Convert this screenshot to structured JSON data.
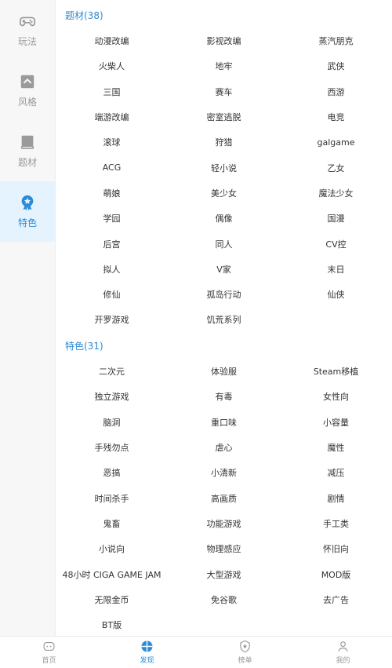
{
  "sidebar": {
    "items": [
      {
        "label": "玩法",
        "icon": "gamepad-icon"
      },
      {
        "label": "风格",
        "icon": "chevron-box-icon"
      },
      {
        "label": "题材",
        "icon": "book-icon"
      },
      {
        "label": "特色",
        "icon": "star-badge-icon",
        "active": true
      }
    ]
  },
  "sections": [
    {
      "title": "题材(38)",
      "tags": [
        "动漫改编",
        "影视改编",
        "蒸汽朋克",
        "火柴人",
        "地牢",
        "武侠",
        "三国",
        "赛车",
        "西游",
        "端游改编",
        "密室逃脱",
        "电竞",
        "滚球",
        "狩猎",
        "galgame",
        "ACG",
        "轻小说",
        "乙女",
        "萌娘",
        "美少女",
        "魔法少女",
        "学园",
        "偶像",
        "国漫",
        "后宫",
        "同人",
        "CV控",
        "拟人",
        "V家",
        "末日",
        "修仙",
        "孤岛行动",
        "仙侠",
        "开罗游戏",
        "饥荒系列"
      ]
    },
    {
      "title": "特色(31)",
      "tags": [
        "二次元",
        "体验服",
        "Steam移植",
        "独立游戏",
        "有毒",
        "女性向",
        "脑洞",
        "重口味",
        "小容量",
        "手残勿点",
        "虐心",
        "魔性",
        "恶搞",
        "小清新",
        "减压",
        "时间杀手",
        "高画质",
        "剧情",
        "鬼畜",
        "功能游戏",
        "手工类",
        "小说向",
        "物理感应",
        "怀旧向",
        "48小时 CIGA GAME JAM",
        "大型游戏",
        "MOD版",
        "无限金币",
        "免谷歌",
        "去广告",
        "BT版"
      ]
    }
  ],
  "bottom_nav": [
    {
      "label": "首页",
      "icon": "home-gamepad-icon"
    },
    {
      "label": "发现",
      "icon": "discover-icon",
      "active": true
    },
    {
      "label": "榜单",
      "icon": "ranking-icon"
    },
    {
      "label": "我的",
      "icon": "profile-icon"
    }
  ],
  "colors": {
    "accent": "#2b8bd6",
    "sidebar_bg": "#f7f7f7",
    "active_bg": "#e5f3fe"
  }
}
